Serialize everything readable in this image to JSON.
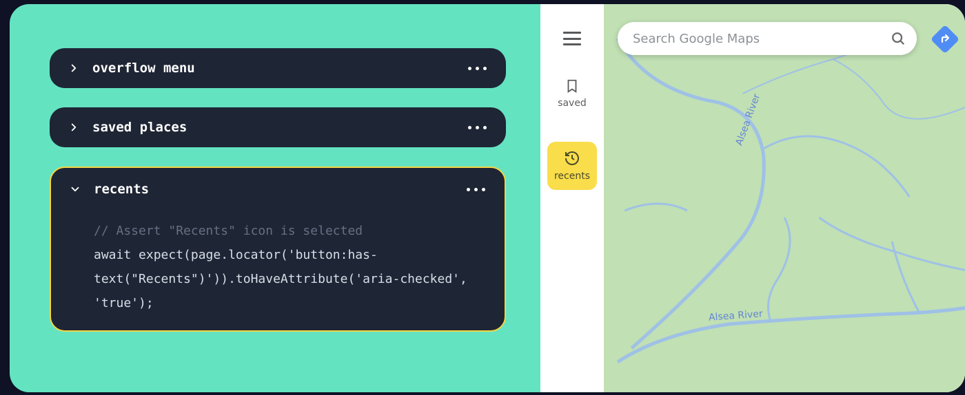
{
  "panel": {
    "items": [
      {
        "title": "overflow menu",
        "expanded": false
      },
      {
        "title": "saved places",
        "expanded": false
      },
      {
        "title": "recents",
        "expanded": true
      }
    ],
    "code": {
      "comment": "// Assert \"Recents\" icon is selected",
      "line": "await expect(page.locator('button:has-text(\"Recents\")')).toHaveAttribute('aria-checked', 'true');"
    }
  },
  "maps": {
    "search_placeholder": "Search Google Maps",
    "sidebar": {
      "saved_label": "saved",
      "recents_label": "recents"
    },
    "river_label_1": "Alsea River",
    "river_label_2": "Alsea River"
  },
  "colors": {
    "panel_bg": "#64e3c1",
    "item_bg": "#1e2534",
    "highlight": "#f5d542",
    "map_land": "#c1e0b4",
    "map_water": "#9fc1e6",
    "directions_blue": "#4f8df5"
  }
}
